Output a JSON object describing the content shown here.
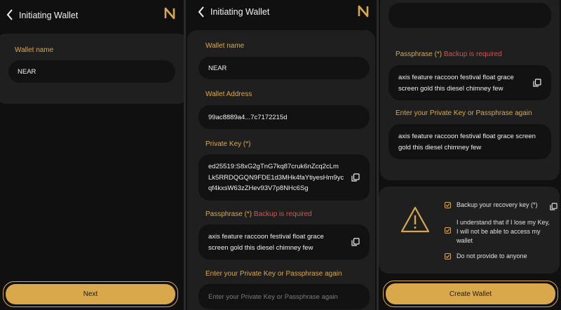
{
  "header": {
    "title": "Initiating Wallet"
  },
  "screen1": {
    "wallet_name_label": "Wallet name",
    "wallet_name_value": "NEAR",
    "next_label": "Next"
  },
  "screen2": {
    "wallet_name_label": "Wallet name",
    "wallet_name_value": "NEAR",
    "wallet_address_label": "Wallet Address",
    "wallet_address_value": "99ac8889a4...7c7172215d",
    "private_key_label": "Private Key (*)",
    "private_key_lines": [
      "ed25519:S8xG2gTnG7kq87cruk6nZcq2cLm",
      "Lk5RRDQGQN9FDE1d3MHk4faYtiyesHm9yc",
      "qf4kxsW63zZHev93V7p8NHc6Sg"
    ],
    "passphrase_label": "Passphrase (*)",
    "backup_required": "Backup is required",
    "passphrase_lines": [
      "axis feature raccoon festival float grace",
      "screen gold this diesel chimney few"
    ],
    "reenter_label": "Enter your Private Key or Passphrase again",
    "reenter_placeholder": "Enter your Private Key or Passphrase again"
  },
  "screen3": {
    "passphrase_label": "Passphrase (*)",
    "backup_required": "Backup is required",
    "passphrase_lines": [
      "axis feature raccoon festival float grace",
      "screen gold this diesel chimney few"
    ],
    "reenter_label": "Enter your Private Key or Passphrase again",
    "reenter_lines": [
      "axis feature raccoon festival float grace screen",
      "gold this diesel chimney few"
    ],
    "checks": [
      {
        "lines": [
          "Backup your recovery key (*)"
        ],
        "checked": true
      },
      {
        "lines": [
          "I understand that if I lose my Key,",
          "I will not be able to access my",
          "wallet"
        ],
        "checked": true
      },
      {
        "lines": [
          "Do not provide to anyone"
        ],
        "checked": true
      }
    ],
    "create_label": "Create Wallet"
  },
  "icons": {
    "back": "chevron-left-icon",
    "logo": "near-logo-icon",
    "copy": "copy-icon",
    "warning": "warning-icon",
    "check": "checkbox-icon"
  },
  "colors": {
    "accent": "#d9a84a",
    "danger": "#d9534f",
    "card": "#1f1f1f",
    "field": "#121212",
    "background": "#101010"
  }
}
